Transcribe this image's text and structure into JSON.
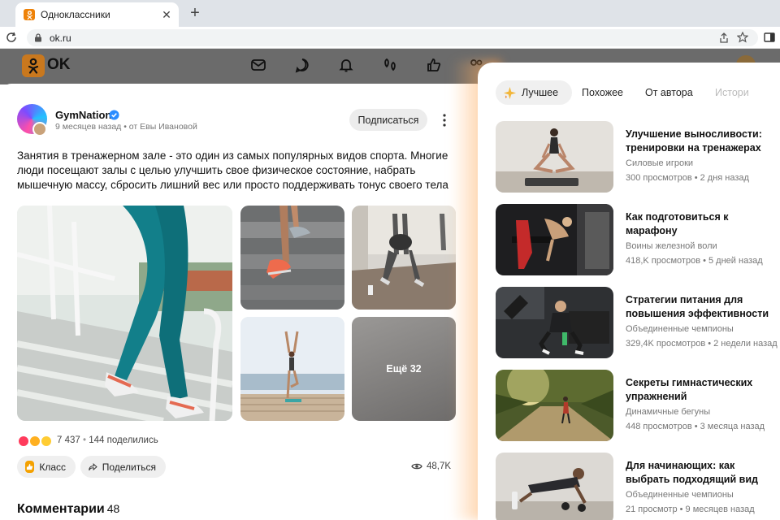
{
  "browser": {
    "tab_title": "Одноклассники",
    "url": "ok.ru"
  },
  "site": {
    "logo_text": "OK",
    "header_icons": [
      "mail-icon",
      "chat-icon",
      "bell-icon",
      "guests-icon",
      "like-icon",
      "friends-icon",
      "video-icon",
      "apps-icon"
    ]
  },
  "post": {
    "author": "GymNation",
    "meta": "9 месяцев назад • от Евы Ивановой",
    "subscribe_label": "Подписаться",
    "text": "Занятия в тренажерном зале - это один из самых популярных видов спорта. Многие люди посещают залы с целью улучшить свое физическое состояние, набрать мышечную массу, сбросить лишний вес или просто поддерживать тонус своего тела",
    "more_photos_label": "Ещё 32",
    "reactions_count": "7 437",
    "shares": "144 поделились",
    "class_label": "Класс",
    "share_label": "Поделиться",
    "views": "48,7K",
    "comments_title": "Комментарии",
    "comments_count": "48"
  },
  "recommendations": {
    "tabs": [
      "Лучшее",
      "Похожее",
      "От автора",
      "Истори"
    ],
    "videos": [
      {
        "title": "Улучшение выносливости: тренировки на тренажерах",
        "channel": "Силовые игроки",
        "stats": "300 просмотров • 2 дня назад"
      },
      {
        "title": "Как подготовиться к марафону",
        "channel": "Воины железной воли",
        "stats": "418,K просмотров • 5 дней назад"
      },
      {
        "title": "Стратегии питания для повышения эффективности",
        "channel": "Объединенные чемпионы",
        "stats": "329,4K просмотров • 2 недели назад"
      },
      {
        "title": "Секреты гимнастических упражнений",
        "channel": "Динамичные бегуны",
        "stats": "448 просмотров • 3 месяца назад"
      },
      {
        "title": "Для начинающих: как выбрать подходящий вид",
        "channel": "Объединенные чемпионы",
        "stats": "21 просмотр • 9 месяцев назад"
      }
    ]
  },
  "colors": {
    "brand_orange": "#ee8208",
    "verified_blue": "#2b8cff"
  }
}
